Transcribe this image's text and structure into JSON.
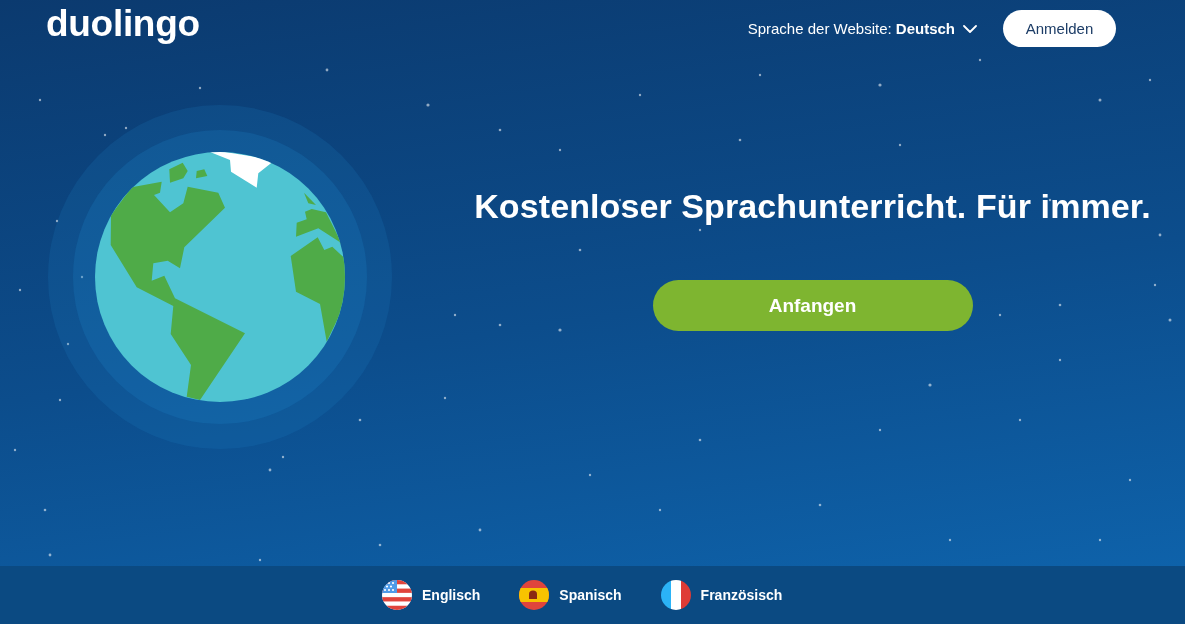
{
  "header": {
    "logo": "duolingo",
    "site_language": "Sprache der Website: **Deutsch**",
    "login_button": "Anmelden"
  },
  "hero": {
    "headline": "Kostenloser Sprachunterricht. Für immer.",
    "start_button": "Anfangen"
  },
  "languages": [
    {
      "name": "Englisch",
      "kind": "us"
    },
    {
      "name": "Spanisch",
      "kind": "es"
    },
    {
      "name": "Französisch",
      "kind": "fr"
    }
  ]
}
